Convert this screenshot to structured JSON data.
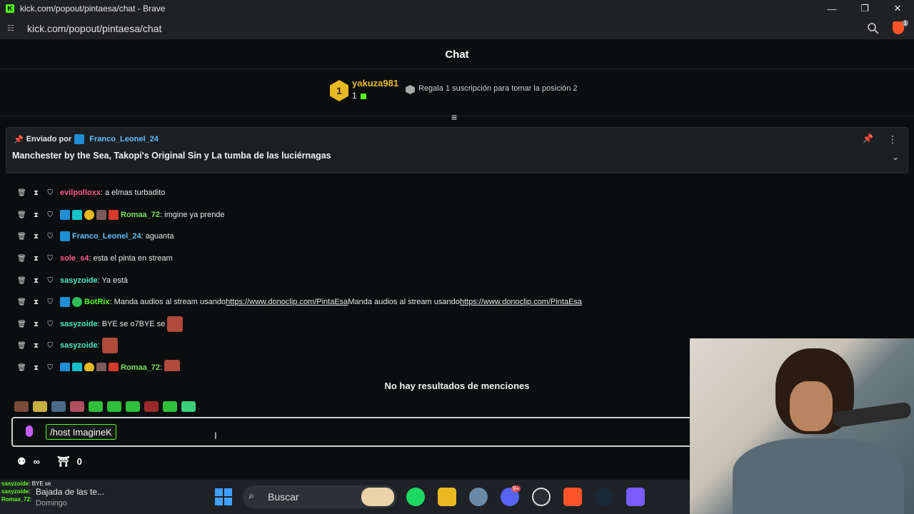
{
  "window": {
    "title": "kick.com/popout/pintaesa/chat - Brave",
    "url": "kick.com/popout/pintaesa/chat",
    "brave_badge": "1"
  },
  "chat": {
    "header": "Chat",
    "leaderboard": {
      "rank": "1",
      "name": "yakuza981",
      "count": "1",
      "promo": "Regala 1 suscripción para tomar la posición 2"
    },
    "pinned": {
      "prefix": "Enviado por",
      "user": "Franco_Leonel_24",
      "message": "Manchester by the Sea, Takopi's Original Sin y La tumba de las luciérnagas"
    },
    "messages": [
      {
        "user": "evilpolloxx",
        "text": ": a elmas turbadito"
      },
      {
        "user": "Romaa_72",
        "text": ": imgine ya prende"
      },
      {
        "user": "Franco_Leonel_24",
        "text": ": aguanta"
      },
      {
        "user": "sole_s4",
        "text": ": esta el pinta en stream"
      },
      {
        "user": "sasyzoide",
        "text": ": Ya está"
      },
      {
        "user": "BotRix",
        "text": ": Manda audios al stream usando ",
        "link1": "https://www.donoclip.com/PintaEsa",
        "mid": "Manda audios al stream usando ",
        "link2": "https://www.donoclip.com/PintaEsa"
      },
      {
        "user": "sasyzoide",
        "text": ": BYE se o7BYE se"
      },
      {
        "user": "sasyzoide",
        "text": ":"
      },
      {
        "user": "Romaa_72",
        "text": ":"
      }
    ],
    "mentions_empty": "No hay resultados de menciones",
    "input": {
      "command_chip": "/host ImagineK"
    },
    "footer": {
      "infinity": "∞",
      "gift_count": "0"
    }
  },
  "taskbar": {
    "overlay_lines": [
      {
        "user": "sasyzoide",
        "text": ": BYE se"
      },
      {
        "user": "sasyzoide",
        "text": ":"
      },
      {
        "user": "Romaa_72",
        "text": ":"
      }
    ],
    "media_title": "Bajada de las te...",
    "media_sub": "Domingo",
    "search_label": "Buscar",
    "discord_badge": "9+"
  },
  "colors": {
    "kick_green": "#53fc18",
    "gold": "#e8b923",
    "background": "#0b0e0f"
  }
}
